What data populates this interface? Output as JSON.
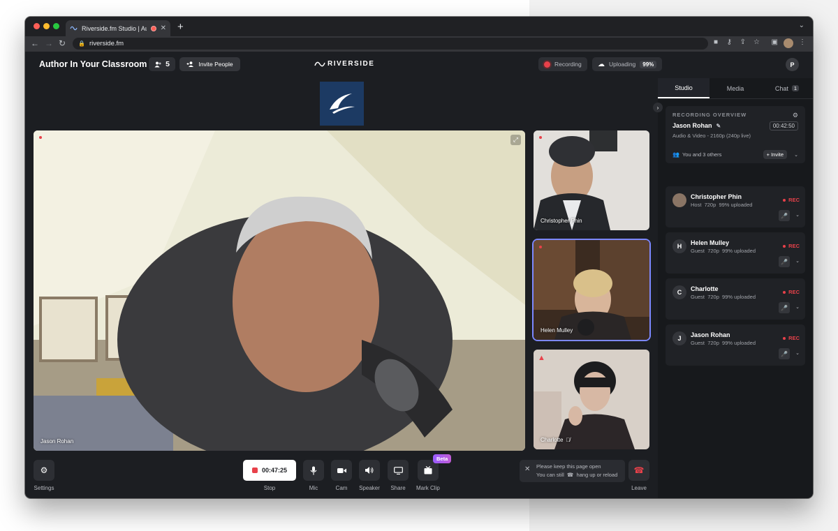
{
  "browser": {
    "tab_title": "Riverside.fm Studio | Autho",
    "url": "riverside.fm"
  },
  "header": {
    "studio_title": "Author In Your Classroom",
    "people_count": "5",
    "invite_label": "Invite People",
    "logo_text": "RIVERSIDE",
    "recording_label": "Recording",
    "uploading_label": "Uploading",
    "upload_percent": "99%",
    "user_initial": "P"
  },
  "stage": {
    "main_speaker": "Jason Rohan",
    "tiles": [
      {
        "name": "Christopher Phin"
      },
      {
        "name": "Helen Mulley"
      },
      {
        "name": "Charlotte"
      }
    ]
  },
  "controls": {
    "settings": "Settings",
    "timer": "00:47:25",
    "stop": "Stop",
    "mic": "Mic",
    "cam": "Cam",
    "speaker": "Speaker",
    "share": "Share",
    "mark_clip": "Mark Clip",
    "beta": "Beta",
    "notice_line1": "Please keep this page open",
    "notice_line2": "You can still",
    "notice_line2b": "hang up or reload",
    "leave": "Leave"
  },
  "panel": {
    "tabs": [
      {
        "label": "Studio"
      },
      {
        "label": "Media"
      },
      {
        "label": "Chat"
      }
    ],
    "chat_count": "1",
    "overview": {
      "title": "RECORDING OVERVIEW",
      "name": "Jason Rohan",
      "time": "00:42:50",
      "subtitle": "Audio & Video - 2160p (240p live)",
      "others": "You and 3 others",
      "invite": "Invite"
    },
    "participants": [
      {
        "name": "Christopher Phin",
        "initial": "",
        "role": "Host",
        "res": "720p",
        "upload": "99% uploaded",
        "rec": "REC"
      },
      {
        "name": "Helen Mulley",
        "initial": "H",
        "role": "Guest",
        "res": "720p",
        "upload": "99% uploaded",
        "rec": "REC"
      },
      {
        "name": "Charlotte",
        "initial": "C",
        "role": "Guest",
        "res": "720p",
        "upload": "99% uploaded",
        "rec": "REC"
      },
      {
        "name": "Jason Rohan",
        "initial": "J",
        "role": "Guest",
        "res": "720p",
        "upload": "99% uploaded",
        "rec": "REC"
      }
    ]
  },
  "colors": {
    "rec_red": "#e8414a",
    "active_tile_border": "#7c88ff",
    "app_bg": "#1c1e22"
  }
}
